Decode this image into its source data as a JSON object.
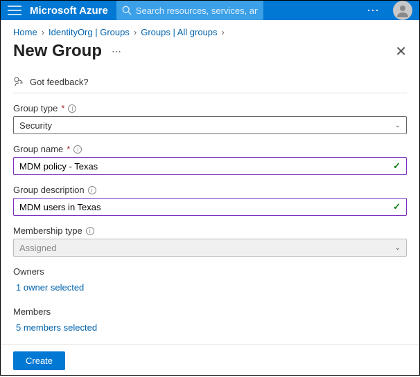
{
  "topbar": {
    "brand": "Microsoft Azure",
    "search_placeholder": "Search resources, services, and docs (G+/)"
  },
  "breadcrumb": {
    "items": [
      "Home",
      "IdentityOrg | Groups",
      "Groups | All groups"
    ]
  },
  "page": {
    "title": "New Group",
    "feedback_label": "Got feedback?"
  },
  "form": {
    "group_type": {
      "label": "Group type",
      "value": "Security"
    },
    "group_name": {
      "label": "Group name",
      "value": "MDM policy - Texas"
    },
    "group_description": {
      "label": "Group description",
      "value": "MDM users in Texas"
    },
    "membership_type": {
      "label": "Membership type",
      "value": "Assigned"
    },
    "owners": {
      "label": "Owners",
      "link": "1 owner selected"
    },
    "members": {
      "label": "Members",
      "link": "5 members selected"
    }
  },
  "footer": {
    "create_label": "Create"
  }
}
